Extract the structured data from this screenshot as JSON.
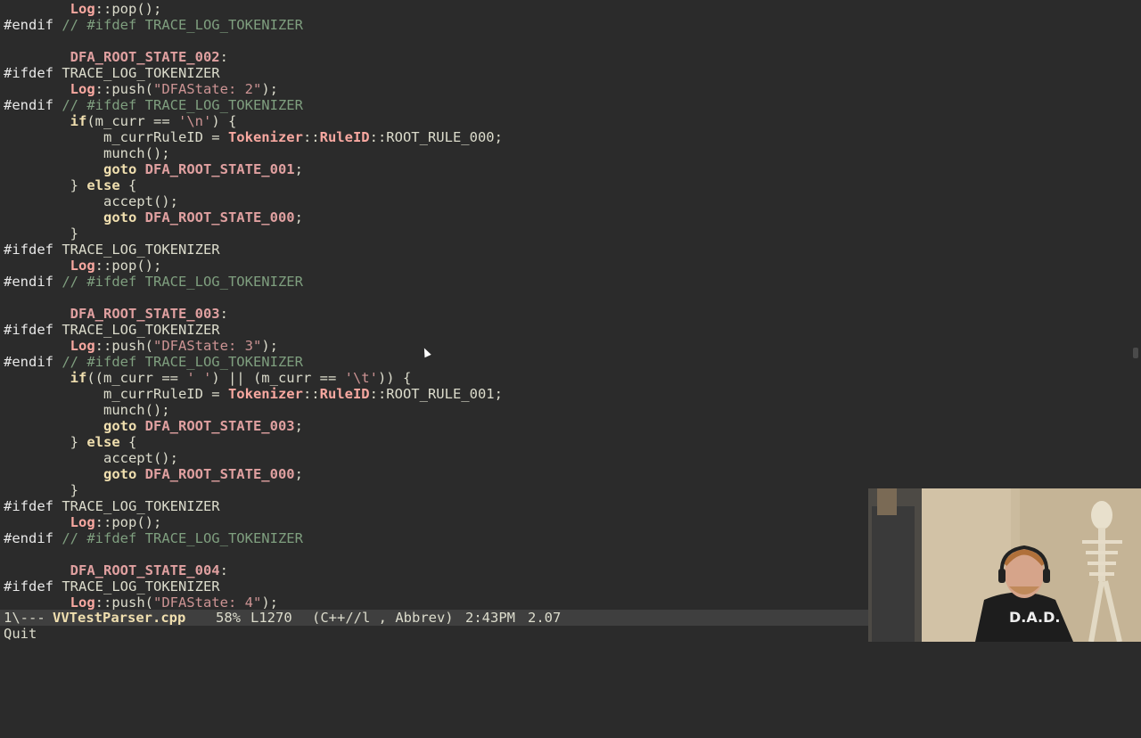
{
  "editor": {
    "lines": [
      [
        [
          "        ",
          "pl"
        ],
        [
          "Log",
          "ty"
        ],
        [
          "::pop();",
          "pl"
        ]
      ],
      [
        [
          "#endif",
          "pp"
        ],
        [
          " // #ifdef TRACE_LOG_TOKENIZER",
          "cm"
        ]
      ],
      [
        [
          "",
          ""
        ]
      ],
      [
        [
          "        ",
          "pl"
        ],
        [
          "DFA_ROOT_STATE_002",
          "lbl"
        ],
        [
          ":",
          "pl"
        ]
      ],
      [
        [
          "#ifdef",
          "pp"
        ],
        [
          " TRACE_LOG_TOKENIZER",
          "pl"
        ]
      ],
      [
        [
          "        ",
          "pl"
        ],
        [
          "Log",
          "ty"
        ],
        [
          "::push(",
          "pl"
        ],
        [
          "\"DFAState: 2\"",
          "str"
        ],
        [
          ");",
          "pl"
        ]
      ],
      [
        [
          "#endif",
          "pp"
        ],
        [
          " // #ifdef TRACE_LOG_TOKENIZER",
          "cm"
        ]
      ],
      [
        [
          "        ",
          "pl"
        ],
        [
          "if",
          "kw"
        ],
        [
          "(m_curr == ",
          "pl"
        ],
        [
          "'\\n'",
          "str"
        ],
        [
          ") {",
          "pl"
        ]
      ],
      [
        [
          "            m_currRuleID = ",
          "pl"
        ],
        [
          "Tokenizer",
          "ty"
        ],
        [
          "::",
          "pl"
        ],
        [
          "RuleID",
          "ty"
        ],
        [
          "::ROOT_RULE_000;",
          "pl"
        ]
      ],
      [
        [
          "            munch();",
          "pl"
        ]
      ],
      [
        [
          "            ",
          "pl"
        ],
        [
          "goto",
          "kw"
        ],
        [
          " ",
          "pl"
        ],
        [
          "DFA_ROOT_STATE_001",
          "lbl"
        ],
        [
          ";",
          "pl"
        ]
      ],
      [
        [
          "        } ",
          "pl"
        ],
        [
          "else",
          "kw"
        ],
        [
          " {",
          "pl"
        ]
      ],
      [
        [
          "            accept();",
          "pl"
        ]
      ],
      [
        [
          "            ",
          "pl"
        ],
        [
          "goto",
          "kw"
        ],
        [
          " ",
          "pl"
        ],
        [
          "DFA_ROOT_STATE_000",
          "lbl"
        ],
        [
          ";",
          "pl"
        ]
      ],
      [
        [
          "        }",
          "pl"
        ]
      ],
      [
        [
          "#ifdef",
          "pp"
        ],
        [
          " TRACE_LOG_TOKENIZER",
          "pl"
        ]
      ],
      [
        [
          "        ",
          "pl"
        ],
        [
          "Log",
          "ty"
        ],
        [
          "::pop();",
          "pl"
        ]
      ],
      [
        [
          "#endif",
          "pp"
        ],
        [
          " // #ifdef TRACE_LOG_TOKENIZER",
          "cm"
        ]
      ],
      [
        [
          "",
          ""
        ]
      ],
      [
        [
          "        ",
          "pl"
        ],
        [
          "DFA_ROOT_STATE_003",
          "lbl"
        ],
        [
          ":",
          "pl"
        ]
      ],
      [
        [
          "#ifdef",
          "pp"
        ],
        [
          " TRACE_LOG_TOKENIZER",
          "pl"
        ]
      ],
      [
        [
          "        ",
          "pl"
        ],
        [
          "Log",
          "ty"
        ],
        [
          "::push(",
          "pl"
        ],
        [
          "\"DFAState: 3\"",
          "str"
        ],
        [
          ");",
          "pl"
        ]
      ],
      [
        [
          "#endif",
          "pp"
        ],
        [
          " // #ifdef TRACE_LOG_TOKENIZER",
          "cm"
        ]
      ],
      [
        [
          "        ",
          "pl"
        ],
        [
          "if",
          "kw"
        ],
        [
          "((m_curr == ",
          "pl"
        ],
        [
          "' '",
          "str"
        ],
        [
          ") || (m_curr == ",
          "pl"
        ],
        [
          "'\\t'",
          "str"
        ],
        [
          ")) {",
          "pl"
        ]
      ],
      [
        [
          "            m_currRuleID = ",
          "pl"
        ],
        [
          "Tokenizer",
          "ty"
        ],
        [
          "::",
          "pl"
        ],
        [
          "RuleID",
          "ty"
        ],
        [
          "::ROOT_RULE_001;",
          "pl"
        ]
      ],
      [
        [
          "            munch();",
          "pl"
        ]
      ],
      [
        [
          "            ",
          "pl"
        ],
        [
          "goto",
          "kw"
        ],
        [
          " ",
          "pl"
        ],
        [
          "DFA_ROOT_STATE_003",
          "lbl"
        ],
        [
          ";",
          "pl"
        ]
      ],
      [
        [
          "        } ",
          "pl"
        ],
        [
          "else",
          "kw"
        ],
        [
          " {",
          "pl"
        ]
      ],
      [
        [
          "            accept();",
          "pl"
        ]
      ],
      [
        [
          "            ",
          "pl"
        ],
        [
          "goto",
          "kw"
        ],
        [
          " ",
          "pl"
        ],
        [
          "DFA_ROOT_STATE_000",
          "lbl"
        ],
        [
          ";",
          "pl"
        ]
      ],
      [
        [
          "        }",
          "pl"
        ]
      ],
      [
        [
          "#ifdef",
          "pp"
        ],
        [
          " TRACE_LOG_TOKENIZER",
          "pl"
        ]
      ],
      [
        [
          "        ",
          "pl"
        ],
        [
          "Log",
          "ty"
        ],
        [
          "::pop();",
          "pl"
        ]
      ],
      [
        [
          "#endif",
          "pp"
        ],
        [
          " // #ifdef TRACE_LOG_TOKENIZER",
          "cm"
        ]
      ],
      [
        [
          "",
          ""
        ]
      ],
      [
        [
          "        ",
          "pl"
        ],
        [
          "DFA_ROOT_STATE_004",
          "lbl"
        ],
        [
          ":",
          "pl"
        ]
      ],
      [
        [
          "#ifdef",
          "pp"
        ],
        [
          " TRACE_LOG_TOKENIZER",
          "pl"
        ]
      ],
      [
        [
          "        ",
          "pl"
        ],
        [
          "Log",
          "ty"
        ],
        [
          "::push(",
          "pl"
        ],
        [
          "\"DFAState: 4\"",
          "str"
        ],
        [
          ");",
          "pl"
        ]
      ]
    ]
  },
  "modeline": {
    "buffer_state": "1\\---",
    "filename": "VVTestParser.cpp",
    "position": "58%",
    "line": "L1270",
    "modes": "(C++//l , Abbrev)",
    "time": "2:43PM",
    "load": "2.07"
  },
  "echo_area": {
    "message": "Quit"
  },
  "colors": {
    "background": "#2b2b2b",
    "modeline_bg": "#3f3f3f",
    "keyword": "#f0dfaf",
    "comment": "#7f9f7f",
    "string": "#cc9393",
    "label": "#e0a0a0"
  }
}
